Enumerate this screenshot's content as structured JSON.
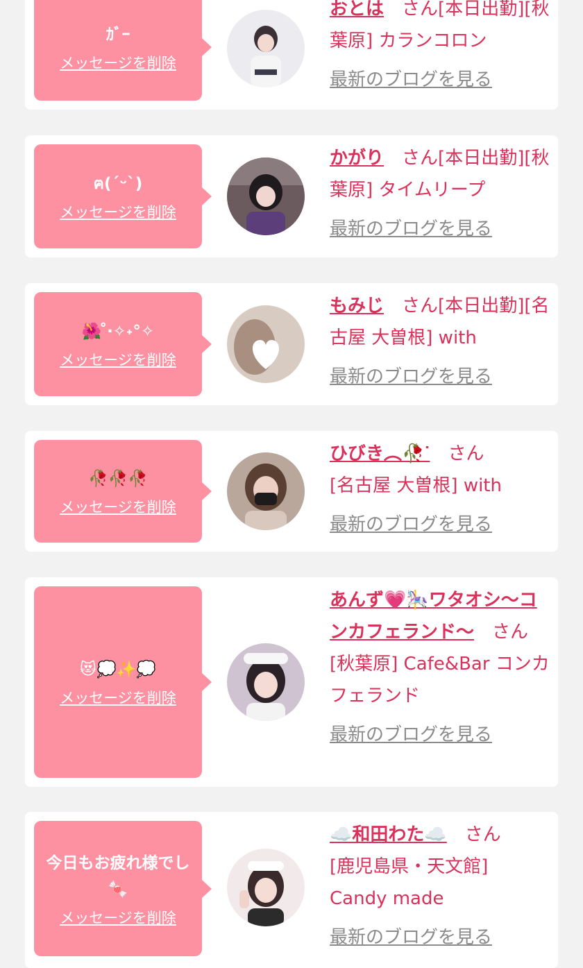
{
  "delete_label": "メッセージを削除",
  "blog_label": "最新のブログを見る",
  "colors": {
    "accent": "#d9315a",
    "bubble": "#fd91a2",
    "muted": "#8a8a8a",
    "background": "#f2f2f2"
  },
  "entries": [
    {
      "message": "ｶﾞｰ",
      "name": "おとは",
      "suffix": "さん",
      "detail": "[本日出勤][秋葉原] カランコロン"
    },
    {
      "message": "ฅ(ˊᵕˋ)",
      "name": "かがり",
      "suffix": "さん",
      "detail": "[本日出勤][秋葉原] タイムリープ"
    },
    {
      "message": "🌺 ̊‧✧˖°✧",
      "name": "もみじ",
      "suffix": "さん",
      "detail": "[本日出勤][名古屋 大曽根] with"
    },
    {
      "message": "🥀🥀🥀",
      "name": "ひびき︵🥀ᐝ",
      "suffix": "さん",
      "detail": "[名古屋 大曽根] with"
    },
    {
      "message": "😻💭✨💭",
      "name": "あんず💗🎠ワタオシ〜コンカフェランド〜",
      "suffix": "さん",
      "detail": "[秋葉原] Cafe&Bar コンカフェランド"
    },
    {
      "message": "今日もお疲れ様でし🍬",
      "name": "☁️和田わた☁️",
      "suffix": "さん",
      "detail": "[鹿児島県・天文館] Candy made"
    }
  ]
}
